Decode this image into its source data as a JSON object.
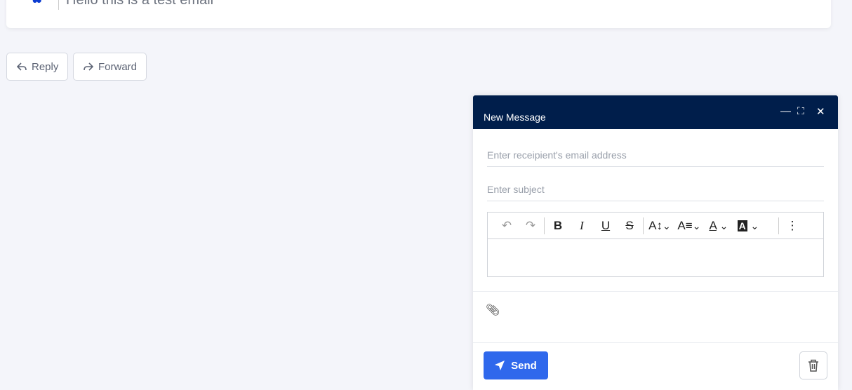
{
  "email": {
    "body_preview": "Hello this is a test email"
  },
  "actions": {
    "reply": "Reply",
    "forward": "Forward"
  },
  "compose": {
    "title": "New Message",
    "to_placeholder": "Enter receipient's email address",
    "subject_placeholder": "Enter subject",
    "send_label": "Send",
    "toolbar": [
      "undo",
      "redo",
      "bold",
      "italic",
      "underline",
      "strikethrough",
      "font-size",
      "font-style",
      "text-color",
      "highlight-color",
      "more"
    ]
  },
  "colors": {
    "header": "#001e4b",
    "send": "#2f68ec"
  }
}
